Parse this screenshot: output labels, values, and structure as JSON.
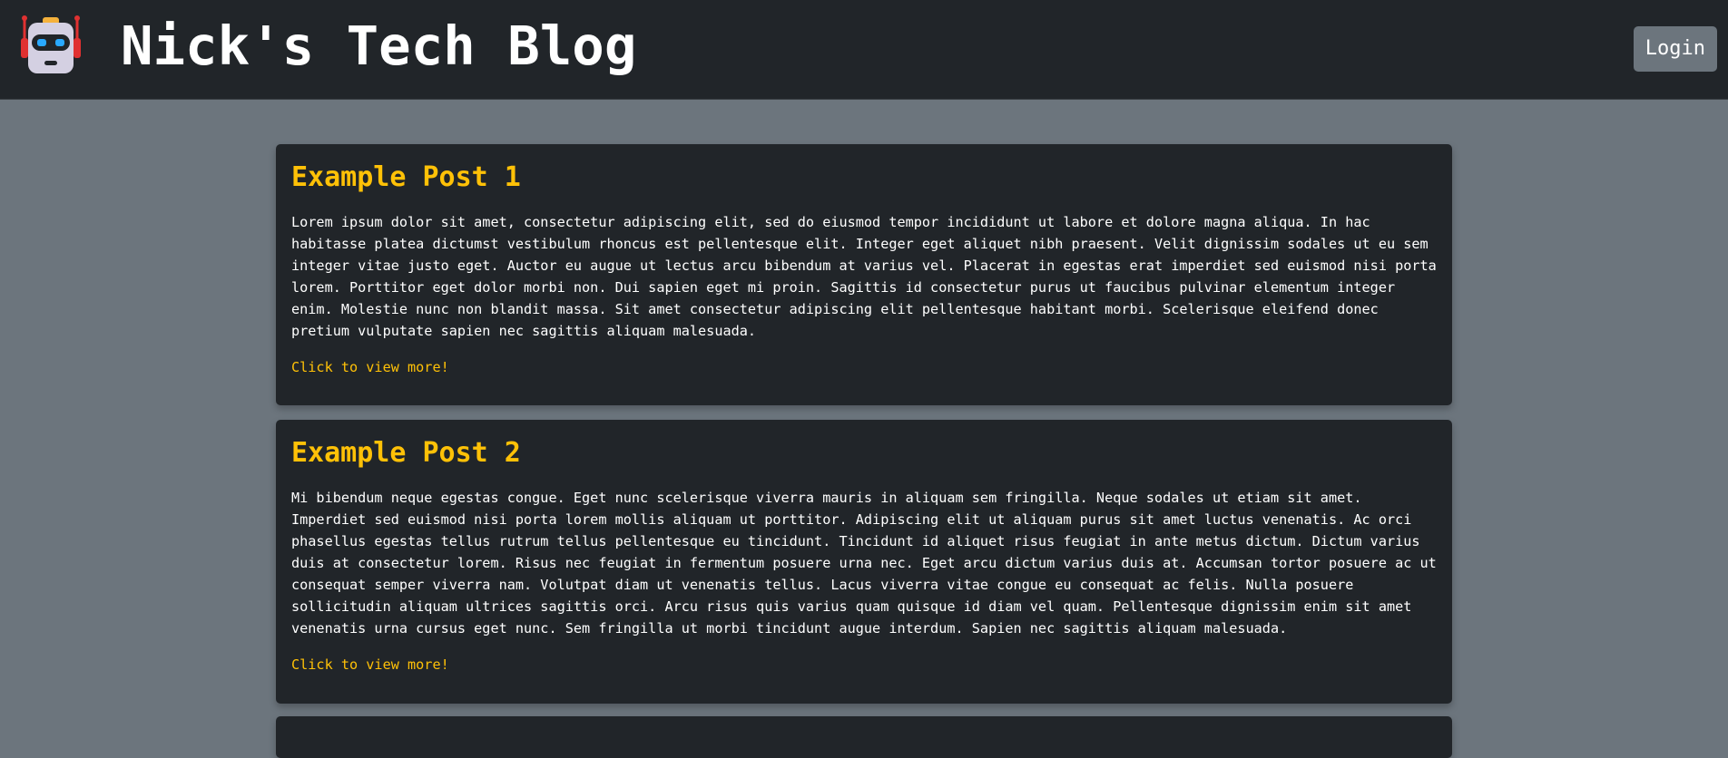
{
  "site": {
    "title": "Nick's Tech Blog",
    "logo_icon": "robot-icon",
    "login_label": "Login"
  },
  "colors": {
    "page_bg": "#6c757d",
    "nav_bg": "#212529",
    "card_bg": "#212529",
    "accent": "#ffc107",
    "text": "#ffffff"
  },
  "posts": [
    {
      "title": "Example Post 1",
      "body": "Lorem ipsum dolor sit amet, consectetur adipiscing elit, sed do eiusmod tempor incididunt ut labore et dolore magna aliqua. In hac habitasse platea dictumst vestibulum rhoncus est pellentesque elit. Integer eget aliquet nibh praesent. Velit dignissim sodales ut eu sem integer vitae justo eget. Auctor eu augue ut lectus arcu bibendum at varius vel. Placerat in egestas erat imperdiet sed euismod nisi porta lorem. Porttitor eget dolor morbi non. Dui sapien eget mi proin. Sagittis id consectetur purus ut faucibus pulvinar elementum integer enim. Molestie nunc non blandit massa. Sit amet consectetur adipiscing elit pellentesque habitant morbi. Scelerisque eleifend donec pretium vulputate sapien nec sagittis aliquam malesuada.",
      "link": "Click to view more!"
    },
    {
      "title": "Example Post 2",
      "body": "Mi bibendum neque egestas congue. Eget nunc scelerisque viverra mauris in aliquam sem fringilla. Neque sodales ut etiam sit amet. Imperdiet sed euismod nisi porta lorem mollis aliquam ut porttitor. Adipiscing elit ut aliquam purus sit amet luctus venenatis. Ac orci phasellus egestas tellus rutrum tellus pellentesque eu tincidunt. Tincidunt id aliquet risus feugiat in ante metus dictum. Dictum varius duis at consectetur lorem. Risus nec feugiat in fermentum posuere urna nec. Eget arcu dictum varius duis at. Accumsan tortor posuere ac ut consequat semper viverra nam. Volutpat diam ut venenatis tellus. Lacus viverra vitae congue eu consequat ac felis. Nulla posuere sollicitudin aliquam ultrices sagittis orci. Arcu risus quis varius quam quisque id diam vel quam. Pellentesque dignissim enim sit amet venenatis urna cursus eget nunc. Sem fringilla ut morbi tincidunt augue interdum. Sapien nec sagittis aliquam malesuada.",
      "link": "Click to view more!"
    }
  ]
}
